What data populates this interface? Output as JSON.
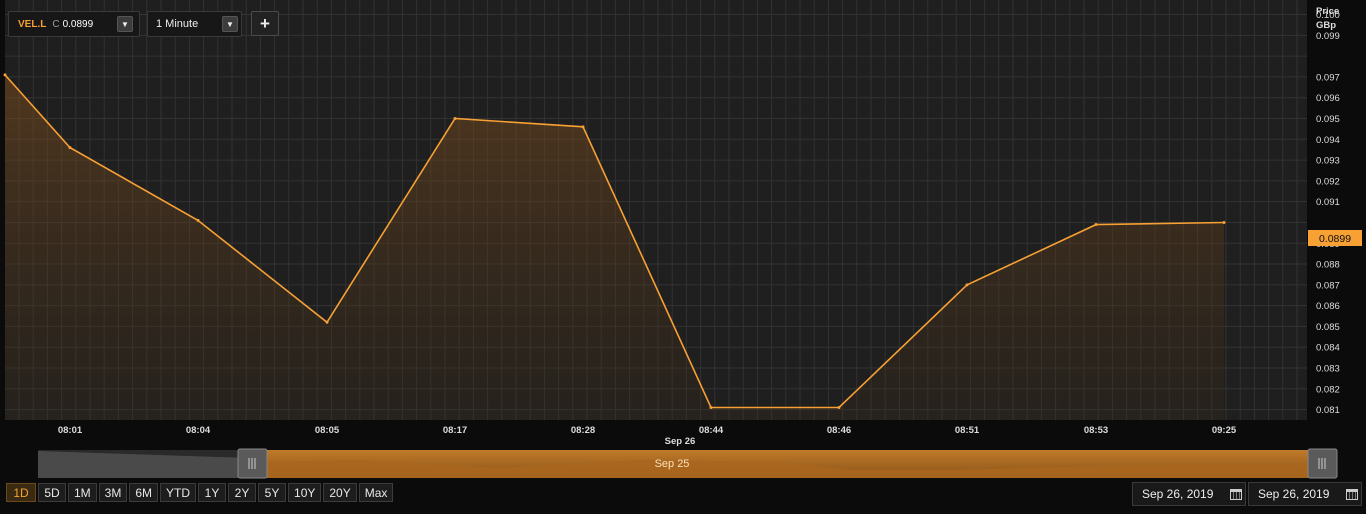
{
  "toolbar": {
    "symbol": "VEL.L",
    "close_prefix": "C",
    "close_value": "0.0899",
    "interval": "1 Minute",
    "add_symbol": "+"
  },
  "y_axis_title": [
    "Price",
    "GBp"
  ],
  "current_price_label": "0.0899",
  "navigator_label": "Sep 25",
  "range_buttons": [
    "1D",
    "5D",
    "1M",
    "3M",
    "6M",
    "YTD",
    "1Y",
    "2Y",
    "5Y",
    "10Y",
    "20Y",
    "Max"
  ],
  "active_range": "1D",
  "date_from": "Sep 26, 2019",
  "date_to": "Sep 26, 2019",
  "colors": {
    "line": "#f7a034",
    "background": "#1f1f1f",
    "grid": "#333333",
    "price_tag": "#f7a034"
  },
  "chart_data": {
    "type": "area",
    "x": [
      "08:01",
      "08:04",
      "08:05",
      "08:17",
      "08:28",
      "08:44",
      "08:46",
      "08:51",
      "08:53",
      "09:25"
    ],
    "series": [
      {
        "values": [
          0.0971,
          0.0967,
          0.0936,
          0.0901,
          0.0852,
          0.095,
          0.0946,
          0.0811,
          0.0811,
          0.087,
          0.0899,
          0.09
        ]
      }
    ],
    "x_sub_label": "Sep 26",
    "y_ticks": [
      0.1,
      0.099,
      0.097,
      0.096,
      0.095,
      0.094,
      0.093,
      0.092,
      0.091,
      0.089,
      0.088,
      0.087,
      0.086,
      0.085,
      0.084,
      0.083,
      0.082,
      0.081
    ],
    "y_tick_labels": [
      "0.100",
      "0.099",
      "0.097",
      "0.096",
      "0.095",
      "0.094",
      "0.093",
      "0.092",
      "0.091",
      "0.089",
      "0.088",
      "0.087",
      "0.086",
      "0.085",
      "0.084",
      "0.083",
      "0.082",
      "0.081"
    ],
    "ylim": [
      0.0805,
      0.1007
    ],
    "grid": true,
    "y_axis_side": "right"
  }
}
